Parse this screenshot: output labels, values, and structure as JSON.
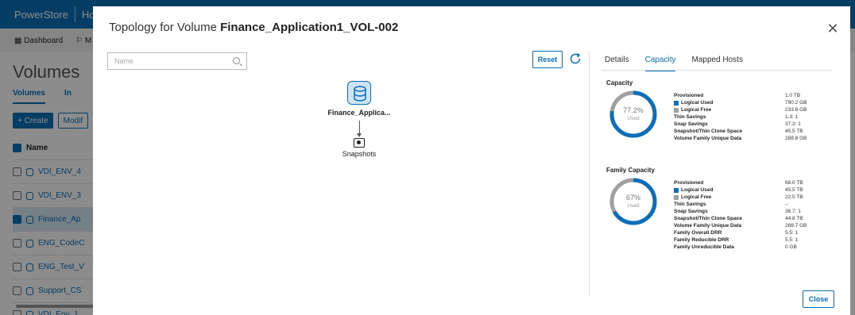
{
  "app": {
    "brand": "PowerStore",
    "brand_second": "Ho",
    "nav_dashboard": "Dashboard",
    "nav_next": "M",
    "page_title": "Volumes",
    "tabs": [
      "Volumes",
      "In"
    ],
    "create_label": "+ Create",
    "modify_label": "Modif",
    "list_header": "Name",
    "rows": [
      {
        "label": "VDI_ENV_4",
        "selected": false
      },
      {
        "label": "VDI_ENV_3",
        "selected": false
      },
      {
        "label": "Finance_Ap",
        "selected": true
      },
      {
        "label": "ENG_CodeC",
        "selected": false
      },
      {
        "label": "ENG_Test_V",
        "selected": false
      },
      {
        "label": "Support_CS",
        "selected": false
      },
      {
        "label": "VDI_Env_1",
        "selected": false
      }
    ]
  },
  "modal": {
    "title_prefix": "Topology for Volume ",
    "title_volume": "Finance_Application1_VOL-002",
    "search_placeholder": "Name",
    "reset_label": "Reset",
    "close_label": "Close",
    "node_label": "Finance_Applica...",
    "snapshots_label": "Snapshots",
    "tabs": [
      "Details",
      "Capacity",
      "Mapped Hosts"
    ],
    "active_tab": "Capacity",
    "capacity": {
      "title": "Capacity",
      "percent": "77.2%",
      "percent_value": 77.2,
      "used_label": "Used",
      "rows": [
        {
          "label": "Provisioned",
          "value": "1.0 TB",
          "swatch": ""
        },
        {
          "label": "Logical Used",
          "value": "790.2 GB",
          "swatch": "blue"
        },
        {
          "label": "Logical Free",
          "value": "233.8 GB",
          "swatch": "gray"
        },
        {
          "label": "Thin Savings",
          "value": "1.3: 1",
          "swatch": ""
        },
        {
          "label": "Snap Savings",
          "value": "37.3: 1",
          "swatch": ""
        },
        {
          "label": "Snapshot/Thin Clone Space",
          "value": "45.5 TB",
          "swatch": ""
        },
        {
          "label": "Volume Family Unique Data",
          "value": "288.8 GB",
          "swatch": ""
        }
      ]
    },
    "family_capacity": {
      "title": "Family Capacity",
      "percent": "67%",
      "percent_value": 67,
      "used_label": "Used",
      "rows": [
        {
          "label": "Provisioned",
          "value": "68.0 TB",
          "swatch": ""
        },
        {
          "label": "Logical Used",
          "value": "45.5 TB",
          "swatch": "blue"
        },
        {
          "label": "Logical Free",
          "value": "22.5 TB",
          "swatch": "gray"
        },
        {
          "label": "Thin Savings",
          "value": "–",
          "swatch": ""
        },
        {
          "label": "Snap Savings",
          "value": "36.7: 1",
          "swatch": ""
        },
        {
          "label": "Snapshot/Thin Clone Space",
          "value": "44.8 TB",
          "swatch": ""
        },
        {
          "label": "Volume Family Unique Data",
          "value": "288.7 GB",
          "swatch": ""
        },
        {
          "label": "Family Overall DRR",
          "value": "5.5: 1",
          "swatch": ""
        },
        {
          "label": "Family Reducible DRR",
          "value": "5.5: 1",
          "swatch": ""
        },
        {
          "label": "Family Unreducible Data",
          "value": "0 GB",
          "swatch": ""
        }
      ]
    }
  },
  "colors": {
    "accent": "#0a6fb8",
    "donut_track": "#a0a0a0"
  }
}
